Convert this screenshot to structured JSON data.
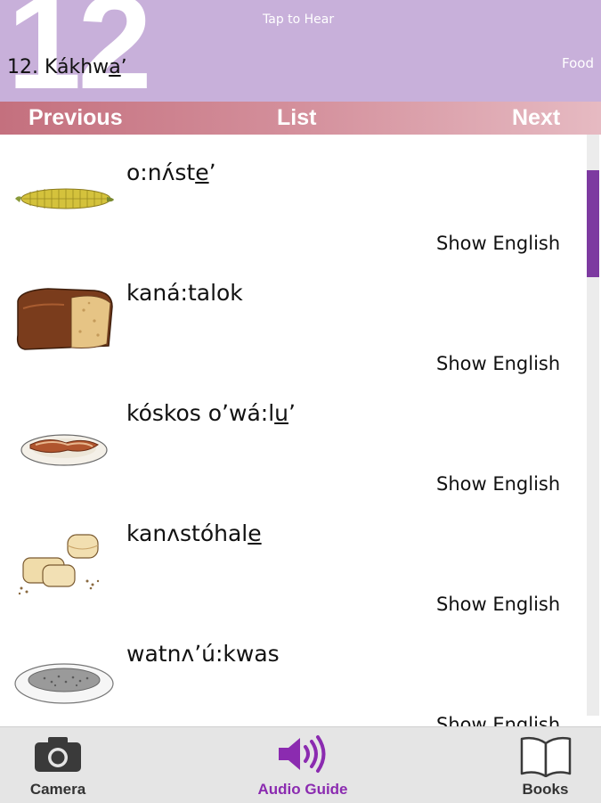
{
  "header": {
    "big_number": "12",
    "tap_hint": "Tap to Hear",
    "chapter_prefix": "12. Kákhw",
    "chapter_underlined": "a",
    "chapter_suffix": "ʼ",
    "topic": "Food"
  },
  "nav": {
    "previous": "Previous",
    "list": "List",
    "next": "Next"
  },
  "items": [
    {
      "icon": "corn-icon",
      "word_before": "o:nʌ́st",
      "word_underlined": "e",
      "word_after": "ʼ",
      "show_label": "Show English"
    },
    {
      "icon": "bread-icon",
      "word_before": "kaná:talok",
      "word_underlined": "",
      "word_after": "",
      "show_label": "Show English"
    },
    {
      "icon": "bacon-plate-icon",
      "word_before": "kóskos  oʼwá:l",
      "word_underlined": "u",
      "word_after": "ʼ",
      "show_label": "Show English"
    },
    {
      "icon": "biscuits-icon",
      "word_before": "kanʌstóhal",
      "word_underlined": "e",
      "word_after": "",
      "show_label": "Show English"
    },
    {
      "icon": "cereal-bowl-icon",
      "word_before": "watnʌʼú:kwas",
      "word_underlined": "",
      "word_after": "",
      "show_label": "Show English"
    }
  ],
  "tabs": {
    "camera": "Camera",
    "audio_guide": "Audio Guide",
    "books": "Books"
  },
  "colors": {
    "header_bg": "#c8b0da",
    "accent": "#8b2bb0",
    "nav_gradient_start": "#c4707e",
    "nav_gradient_end": "#e6bac2"
  }
}
